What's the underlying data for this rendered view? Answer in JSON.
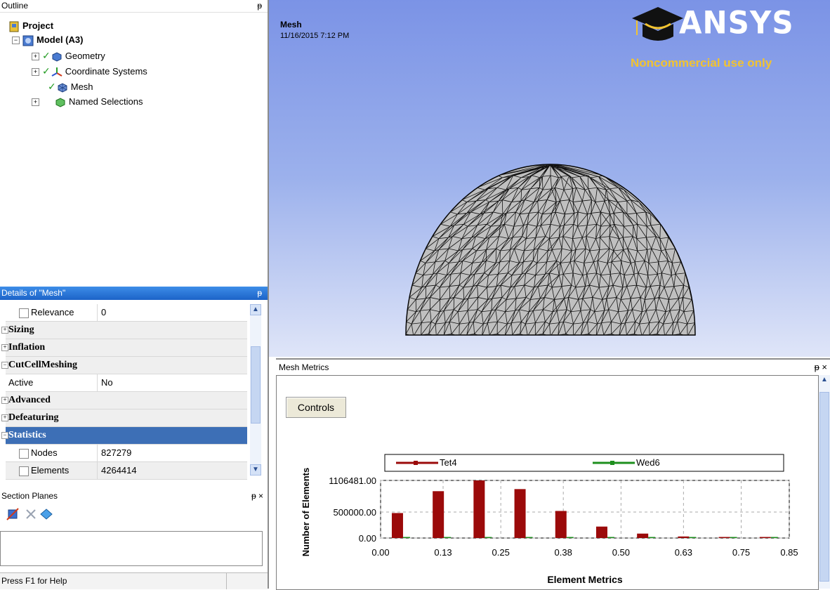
{
  "outline": {
    "title": "Outline",
    "pin": "ᵽ",
    "tree": [
      {
        "label": "Project"
      },
      {
        "label": "Model (A3)"
      },
      {
        "label": "Geometry"
      },
      {
        "label": "Coordinate Systems"
      },
      {
        "label": "Mesh"
      },
      {
        "label": "Named Selections"
      }
    ]
  },
  "details": {
    "title": "Details of \"Mesh\"",
    "rows": [
      {
        "label": "Relevance",
        "value": "0"
      },
      {
        "label": "Sizing"
      },
      {
        "label": "Inflation"
      },
      {
        "label": "CutCellMeshing"
      },
      {
        "label": "Active",
        "value": "No"
      },
      {
        "label": "Advanced"
      },
      {
        "label": "Defeaturing"
      },
      {
        "label": "Statistics"
      },
      {
        "label": "Nodes",
        "value": "827279"
      },
      {
        "label": "Elements",
        "value": "4264414"
      }
    ]
  },
  "section_planes": {
    "title": "Section Planes",
    "close": "ᵽ ×"
  },
  "status": {
    "text": "Press F1 for Help"
  },
  "viewport": {
    "title": "Mesh",
    "date": "11/16/2015 7:12 PM",
    "logo": "ANSYS",
    "logo_sub": "Noncommercial use only"
  },
  "mesh_metrics": {
    "title": "Mesh Metrics",
    "controls_label": "Controls",
    "close": "ᵽ ×"
  },
  "chart_data": {
    "type": "bar",
    "xlabel": "Element Metrics",
    "ylabel": "Number of Elements",
    "x_ticks": [
      "0.00",
      "0.13",
      "0.25",
      "0.38",
      "0.50",
      "0.63",
      "0.75",
      "0.85"
    ],
    "y_ticks": [
      "1106481.00",
      "500000.00",
      "0.00"
    ],
    "xlim": [
      0,
      0.85
    ],
    "ylim": [
      0,
      1106481
    ],
    "legend_placement": "top",
    "series": [
      {
        "name": "Tet4",
        "color": "#9b0a0a",
        "x": [
          0.035,
          0.12,
          0.205,
          0.29,
          0.375,
          0.46,
          0.545,
          0.63,
          0.715,
          0.8
        ],
        "values": [
          480000,
          900000,
          1106481,
          940000,
          520000,
          220000,
          85000,
          30000,
          8000,
          3000
        ]
      },
      {
        "name": "Wed6",
        "color": "#1e8f1e",
        "x": [
          0.035,
          0.12,
          0.205,
          0.29,
          0.375,
          0.46,
          0.545,
          0.63,
          0.715,
          0.8
        ],
        "values": [
          15000,
          15000,
          15000,
          15000,
          15000,
          10000,
          8000,
          5000,
          3000,
          2000
        ]
      }
    ]
  }
}
